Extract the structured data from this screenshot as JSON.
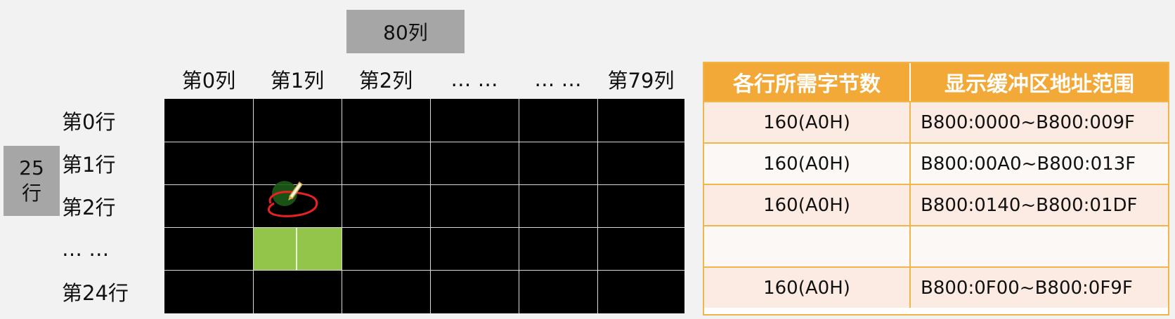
{
  "cols_box": "80列",
  "rows_box": [
    "25",
    "行"
  ],
  "col_headers": [
    "第0列",
    "第1列",
    "第2列",
    "… …",
    "… …",
    "第79列"
  ],
  "row_headers": [
    "第0行",
    "第1行",
    "第2行",
    "… …",
    "第24行"
  ],
  "highlight": {
    "color": "#92c54a"
  },
  "colors": {
    "grid_bg": "#000000",
    "header_orange": "#f3a937",
    "row_tint": "#fcebe2"
  },
  "table": {
    "headers": [
      "各行所需字节数",
      "显示缓冲区地址范围"
    ],
    "rows": [
      {
        "bytes": "160(A0H)",
        "range": "B800:0000~B800:009F"
      },
      {
        "bytes": "160(A0H)",
        "range": "B800:00A0~B800:013F"
      },
      {
        "bytes": "160(A0H)",
        "range": "B800:0140~B800:01DF"
      },
      {
        "bytes": "",
        "range": ""
      },
      {
        "bytes": "160(A0H)",
        "range": "B800:0F00~B800:0F9F"
      }
    ]
  }
}
